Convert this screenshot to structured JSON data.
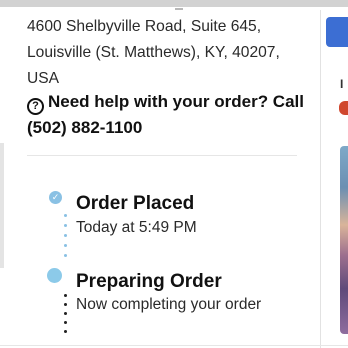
{
  "store": {
    "address_line1": "4600 Shelbyville Road, Suite 645,",
    "address_line2": "Louisville (St. Matthews), KY, 40207,",
    "address_line3": "USA"
  },
  "help": {
    "icon": "?",
    "line1": "Need help with your order? Call",
    "line2": "(502) 882-1100"
  },
  "steps": [
    {
      "title": "Order Placed",
      "subtitle": "Today at 5:49 PM",
      "status": "complete",
      "icon": "check-circle-icon"
    },
    {
      "title": "Preparing Order",
      "subtitle": "Now completing your order",
      "status": "in-progress",
      "icon": "progress-dot-icon"
    }
  ],
  "colors": {
    "step_complete": "#8ac1e4",
    "step_active": "#8ccae9",
    "accent_blue": "#3c6ed3",
    "accent_red": "#d0472e",
    "text_primary": "#111111"
  },
  "right_panel": {
    "partial_letter": "I"
  }
}
